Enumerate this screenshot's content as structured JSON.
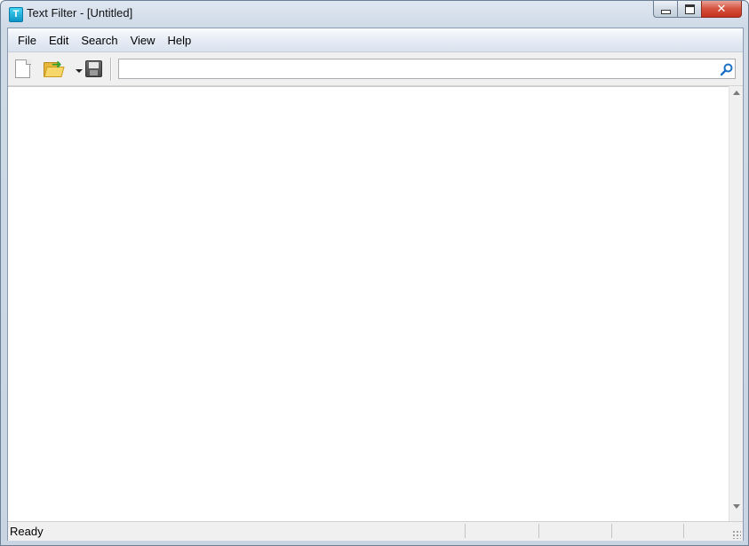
{
  "window": {
    "title": "Text Filter - [Untitled]",
    "app_icon_glyph": "T",
    "app_icon": "filter-app-icon",
    "close_glyph": "✕"
  },
  "menu": {
    "items": [
      "File",
      "Edit",
      "Search",
      "View",
      "Help"
    ]
  },
  "toolbar": {
    "new_icon": "new-file-icon",
    "open_icon": "open-folder-icon",
    "save_icon": "save-disk-icon",
    "search_value": "",
    "search_icon": "magnifier-icon"
  },
  "editor": {
    "content": ""
  },
  "status": {
    "text": "Ready"
  },
  "colors": {
    "title_gradient_top": "#dfe7f1",
    "close_button": "#c4321f",
    "app_icon": "#0d95c6"
  }
}
